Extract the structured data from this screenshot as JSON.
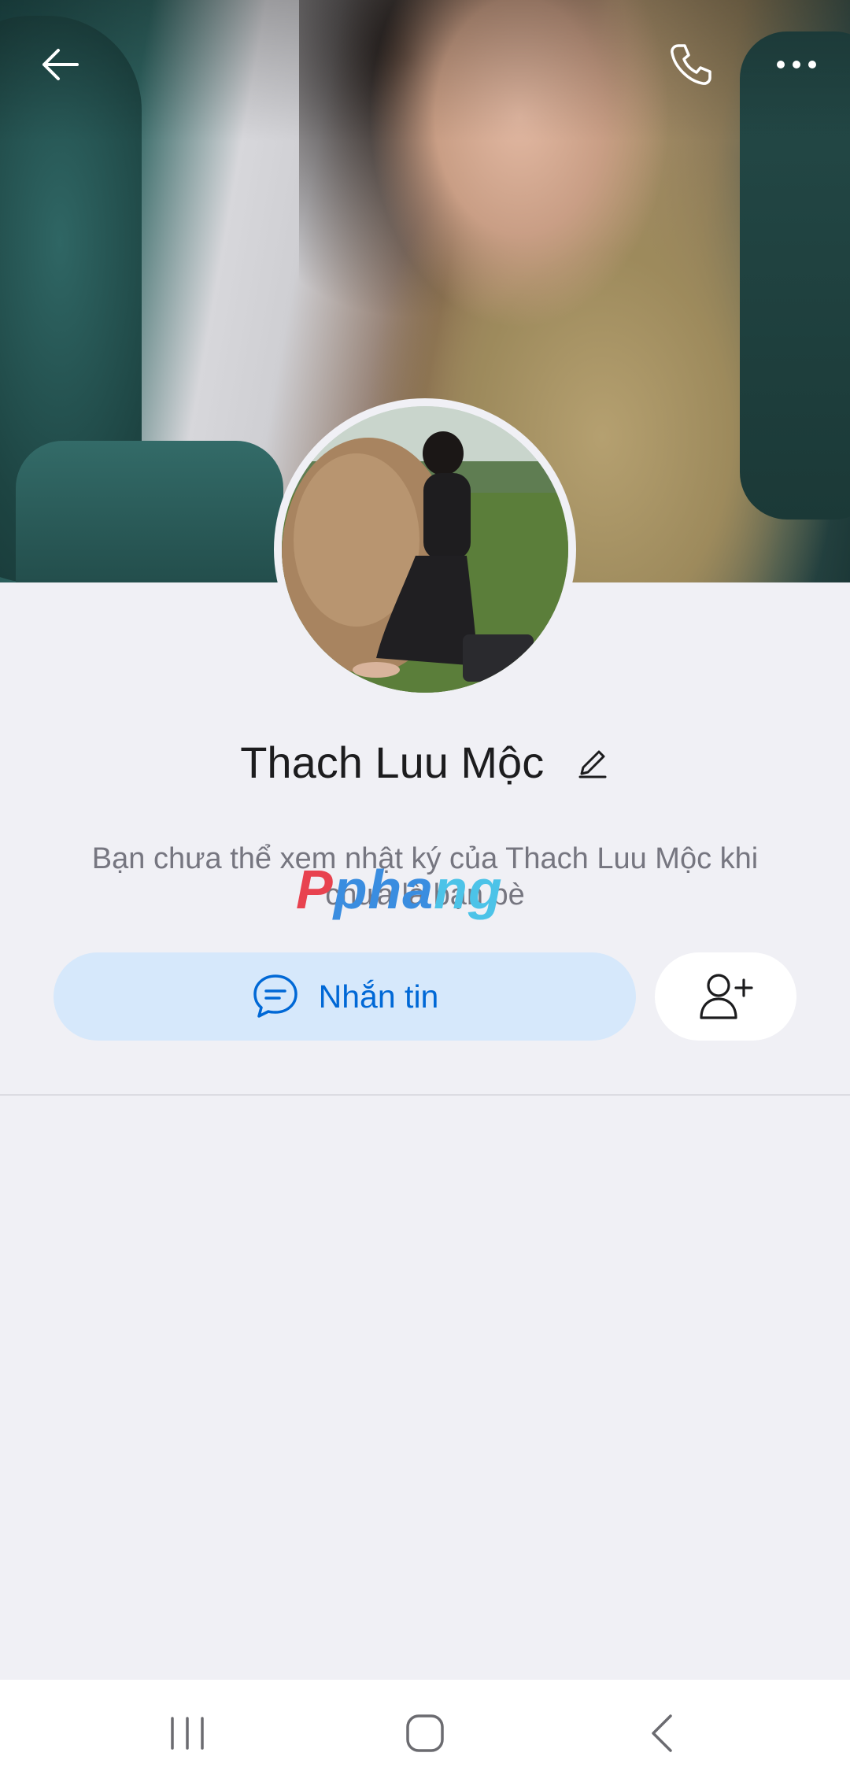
{
  "profile": {
    "name": "Thach Luu Mộc",
    "notice": "Bạn chưa thể xem nhật ký của Thach Luu Mộc khi chưa là bạn bè"
  },
  "actions": {
    "message_label": "Nhắn tin"
  },
  "watermark": {
    "part1": "P",
    "part2": "pha",
    "part3": "ng"
  },
  "colors": {
    "accent": "#0068d6",
    "accent_bg": "#d6e8fb",
    "background": "#f0f0f5"
  },
  "icons": {
    "back": "arrow-left",
    "call": "phone",
    "more": "ellipsis",
    "edit": "pencil",
    "message": "chat-bubble",
    "add_friend": "person-plus",
    "nav_recents": "three-bars",
    "nav_home": "rounded-square",
    "nav_back": "chevron-left"
  }
}
